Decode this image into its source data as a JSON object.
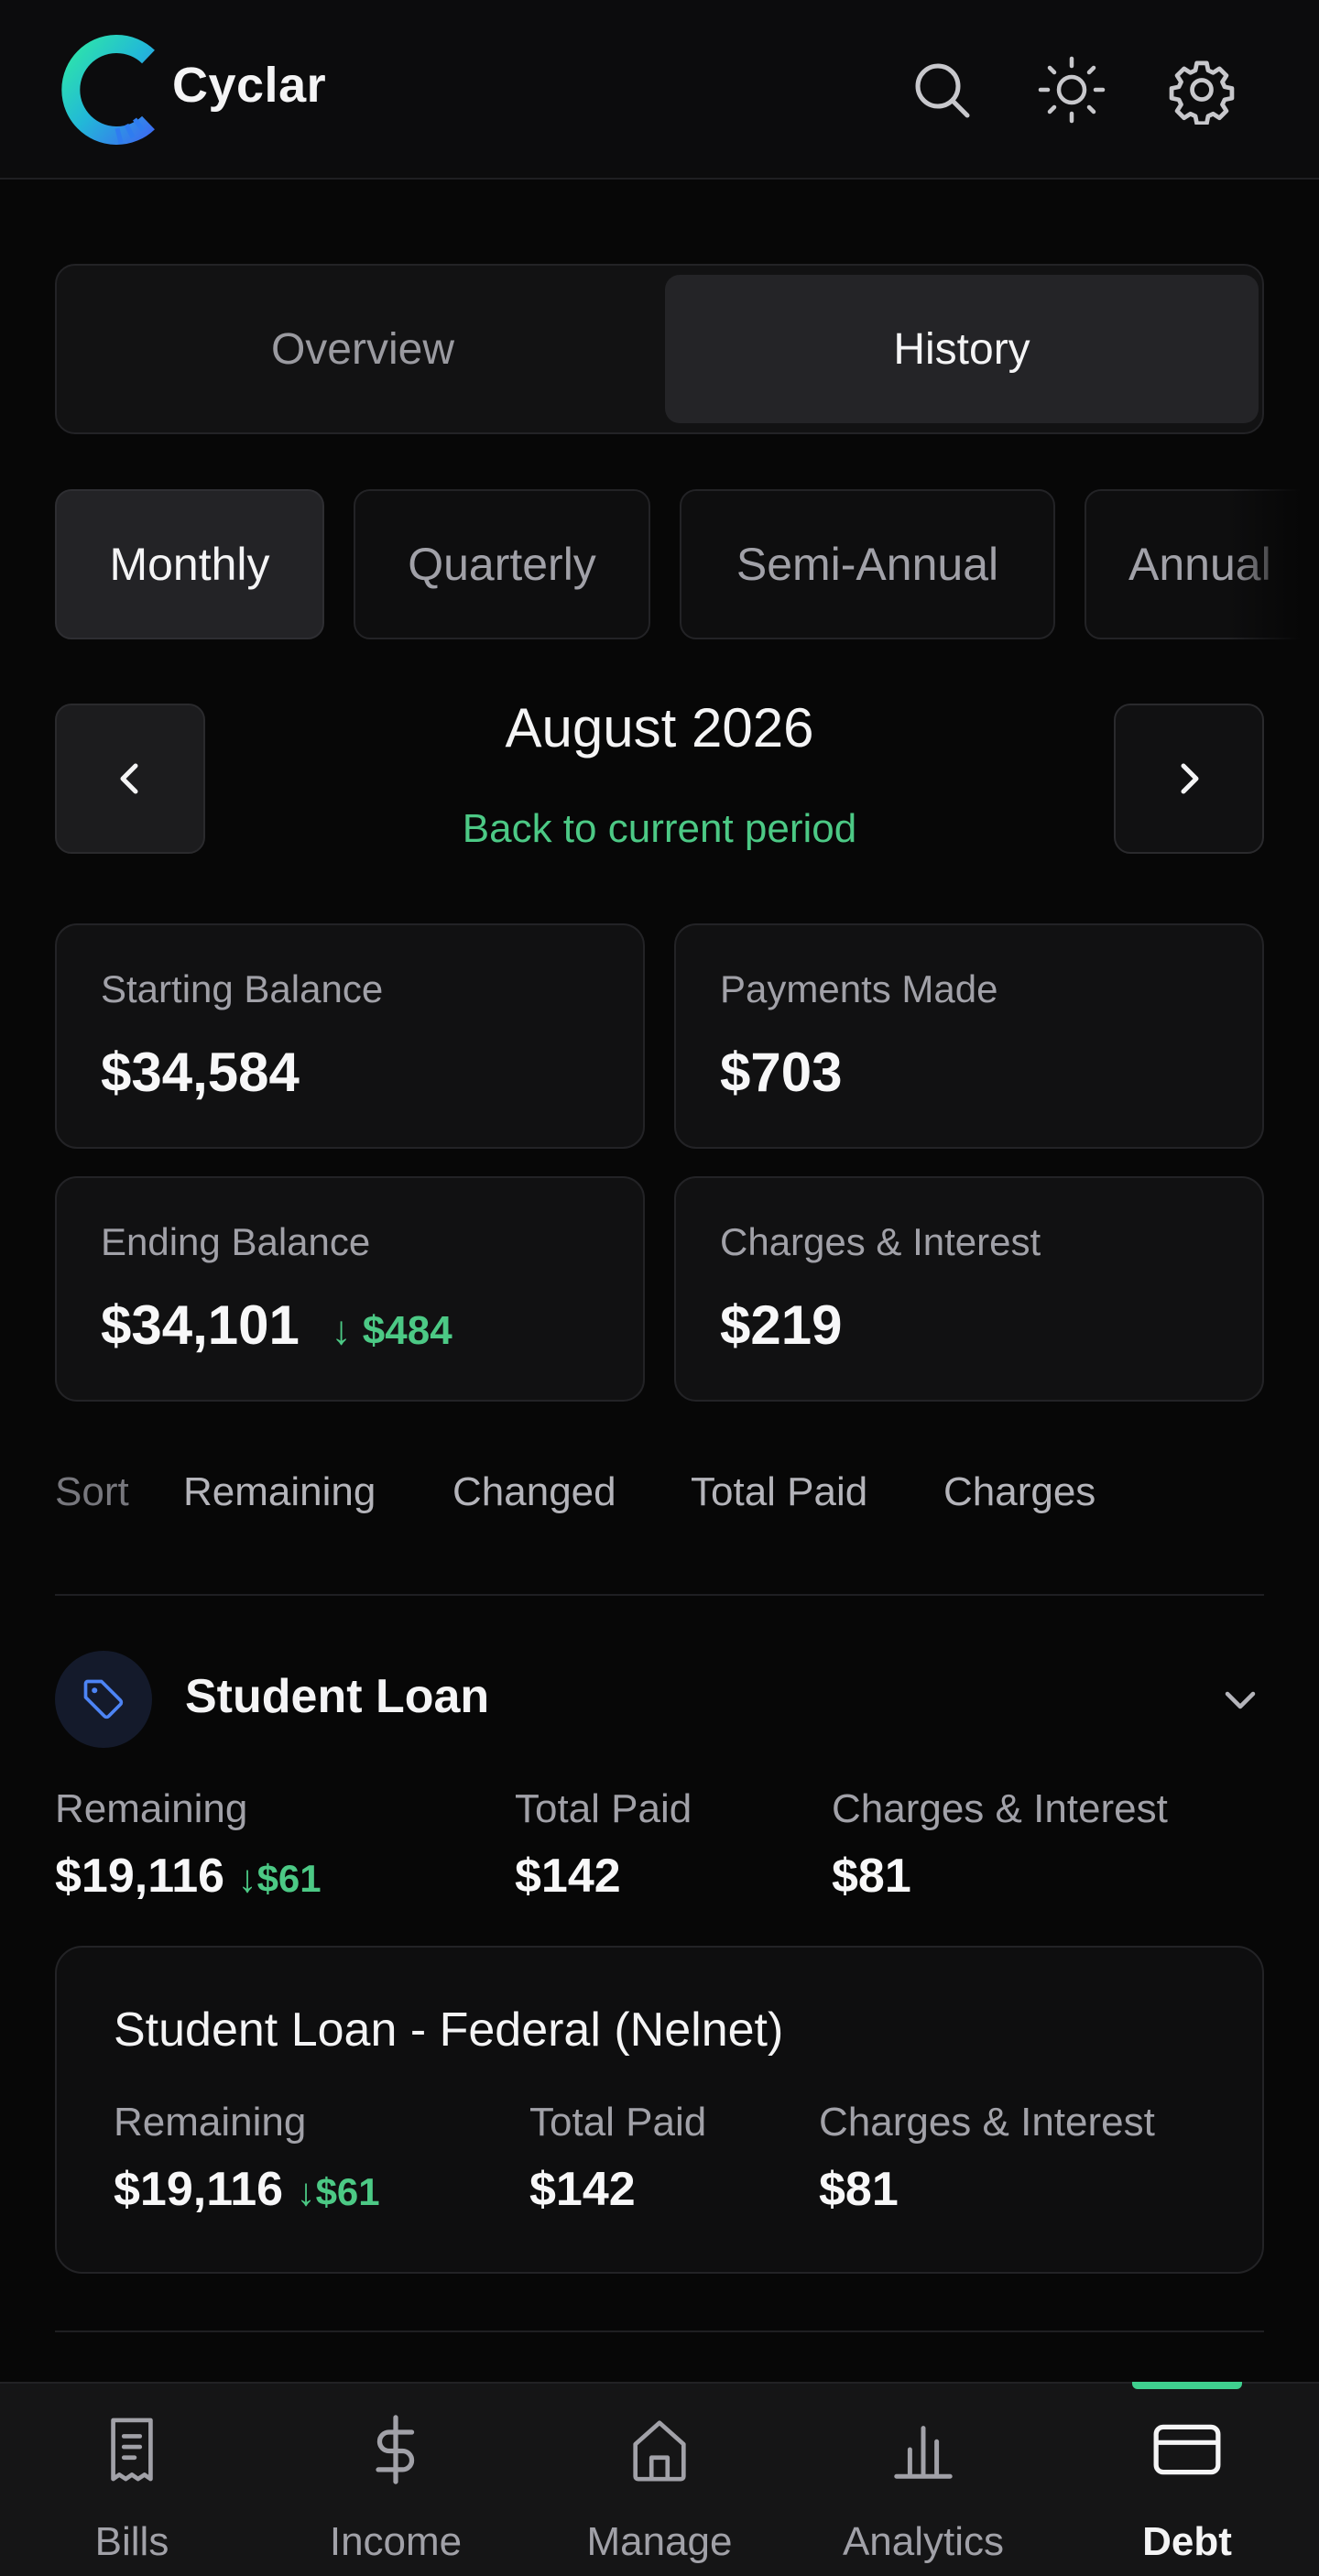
{
  "header": {
    "brand": "Cyclar",
    "icons": [
      "search-icon",
      "sun-icon",
      "gear-icon"
    ]
  },
  "view_toggle": {
    "tabs": [
      {
        "label": "Overview",
        "active": false
      },
      {
        "label": "History",
        "active": true
      }
    ]
  },
  "period_filter": {
    "options": [
      {
        "label": "Monthly",
        "active": true
      },
      {
        "label": "Quarterly",
        "active": false
      },
      {
        "label": "Semi-Annual",
        "active": false
      },
      {
        "label": "Annual",
        "active": false
      }
    ]
  },
  "period": {
    "title": "August 2026",
    "back_link": "Back to current period"
  },
  "summary": {
    "starting_balance": {
      "label": "Starting Balance",
      "value": "$34,584"
    },
    "payments_made": {
      "label": "Payments Made",
      "value": "$703"
    },
    "ending_balance": {
      "label": "Ending Balance",
      "value": "$34,101",
      "delta": "$484"
    },
    "charges_interest": {
      "label": "Charges & Interest",
      "value": "$219"
    }
  },
  "sort": {
    "label": "Sort",
    "options": [
      "Remaining",
      "Changed",
      "Total Paid",
      "Charges"
    ]
  },
  "debt_group": {
    "title": "Student Loan",
    "remaining_label": "Remaining",
    "remaining": "$19,116",
    "remaining_delta": "$61",
    "total_paid_label": "Total Paid",
    "total_paid": "$142",
    "charges_label": "Charges & Interest",
    "charges": "$81",
    "accounts": [
      {
        "name": "Student Loan - Federal (Nelnet)",
        "remaining_label": "Remaining",
        "remaining": "$19,116",
        "remaining_delta": "$61",
        "total_paid_label": "Total Paid",
        "total_paid": "$142",
        "charges_label": "Charges & Interest",
        "charges": "$81"
      }
    ]
  },
  "bottom_nav": {
    "tabs": [
      {
        "label": "Bills",
        "icon": "receipt-icon",
        "active": false
      },
      {
        "label": "Income",
        "icon": "dollar-icon",
        "active": false
      },
      {
        "label": "Manage",
        "icon": "home-icon",
        "active": false
      },
      {
        "label": "Analytics",
        "icon": "bar-chart-icon",
        "active": false
      },
      {
        "label": "Debt",
        "icon": "credit-card-icon",
        "active": true
      }
    ]
  },
  "colors": {
    "accent_green": "#4cc985",
    "background": "#070707",
    "card": "#111112"
  }
}
